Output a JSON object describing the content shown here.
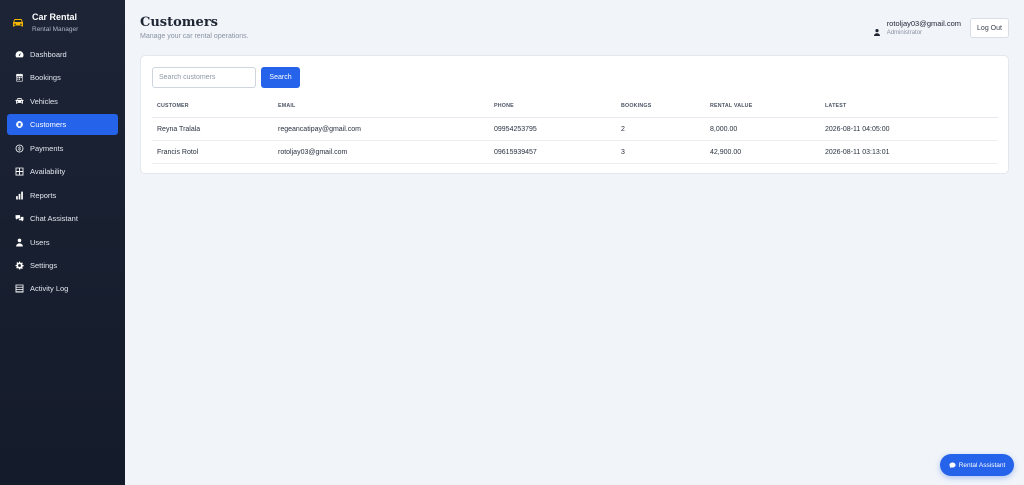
{
  "brand": {
    "title": "Car Rental",
    "subtitle": "Rental Manager",
    "icon": "car-icon"
  },
  "sidebar": {
    "items": [
      {
        "label": "Dashboard",
        "icon": "gauge-icon",
        "active": false
      },
      {
        "label": "Bookings",
        "icon": "calendar-icon",
        "active": false
      },
      {
        "label": "Vehicles",
        "icon": "car-icon",
        "active": false
      },
      {
        "label": "Customers",
        "icon": "customers-icon",
        "active": true
      },
      {
        "label": "Payments",
        "icon": "dollar-icon",
        "active": false
      },
      {
        "label": "Availability",
        "icon": "grid-icon",
        "active": false
      },
      {
        "label": "Reports",
        "icon": "bar-chart-icon",
        "active": false
      },
      {
        "label": "Chat Assistant",
        "icon": "chat-icon",
        "active": false
      },
      {
        "label": "Users",
        "icon": "user-icon",
        "active": false
      },
      {
        "label": "Settings",
        "icon": "gear-icon",
        "active": false
      },
      {
        "label": "Activity Log",
        "icon": "list-icon",
        "active": false
      }
    ]
  },
  "header": {
    "title": "Customers",
    "subtitle": "Manage your car rental operations.",
    "user_email": "rotoljay03@gmail.com",
    "user_role": "Administrator",
    "logout_label": "Log Out"
  },
  "search": {
    "placeholder": "Search customers",
    "value": "",
    "button_label": "Search"
  },
  "table": {
    "columns": [
      "CUSTOMER",
      "EMAIL",
      "PHONE",
      "BOOKINGS",
      "RENTAL VALUE",
      "LATEST"
    ],
    "rows": [
      [
        "Reyna Tralala",
        "regeancatipay@gmail.com",
        "09954253795",
        "2",
        "8,000.00",
        "2026-08-11 04:05:00"
      ],
      [
        "Francis Rotol",
        "rotoljay03@gmail.com",
        "09615939457",
        "3",
        "42,900.00",
        "2026-08-11 03:13:01"
      ]
    ]
  },
  "assistant": {
    "label": "Rental Assistant",
    "icon": "chat-bubble-icon"
  },
  "colors": {
    "accent": "#2563eb",
    "sidebar_bg": "#1c2436",
    "page_bg": "#f1f4f9"
  }
}
